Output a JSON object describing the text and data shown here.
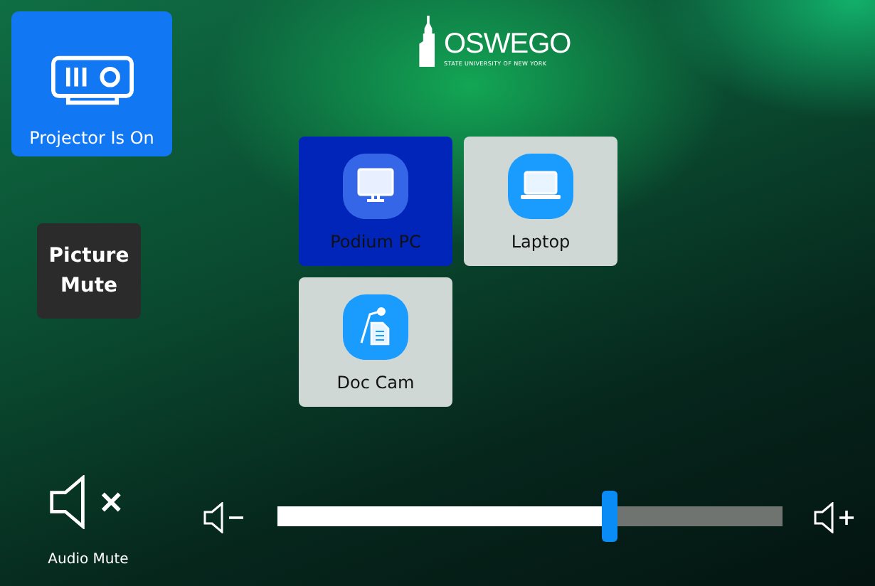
{
  "projector": {
    "label": "Projector Is On",
    "on": true
  },
  "picture_mute": {
    "label": "Picture Mute",
    "on": false
  },
  "logo": {
    "name": "OSWEGO",
    "subtitle": "STATE UNIVERSITY OF NEW YORK"
  },
  "sources": [
    {
      "label": "Podium PC",
      "kind": "monitor",
      "selected": true
    },
    {
      "label": "Laptop",
      "kind": "laptop",
      "selected": false
    },
    {
      "label": "Doc Cam",
      "kind": "doc-camera",
      "selected": false
    }
  ],
  "audio_mute": {
    "label": "Audio Mute",
    "on": false
  },
  "volume": {
    "level": 0.66
  }
}
